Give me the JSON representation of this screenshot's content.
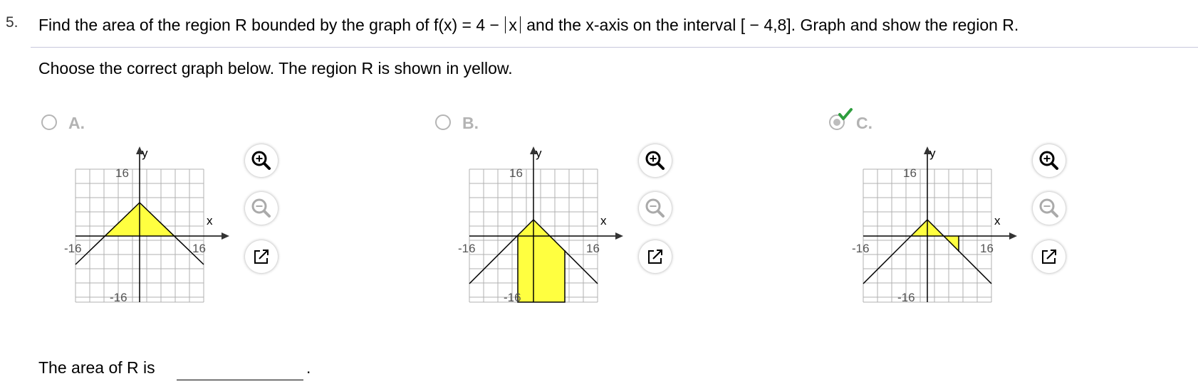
{
  "question": {
    "number": "5.",
    "text_part1": "Find the area of the region R bounded by the graph of f(x) = 4 −",
    "abs_inner": "x",
    "text_part2": "and the x-axis on the interval [ − 4,8]. Graph and show the region R."
  },
  "instruction": "Choose the correct graph below. The region R is shown in yellow.",
  "options": [
    {
      "label": "A.",
      "selected": false
    },
    {
      "label": "B.",
      "selected": false
    },
    {
      "label": "C.",
      "selected": true,
      "marked_correct": true
    }
  ],
  "graph_labels": {
    "x_axis": "x",
    "y_axis": "y",
    "tick_max": "16",
    "tick_min": "-16",
    "tick_neg_x": "-16"
  },
  "tools": {
    "zoom_in": "zoom-in-icon",
    "zoom_out": "zoom-out-icon",
    "popout": "popout-icon"
  },
  "answer": {
    "label": "The area of R is",
    "value": "",
    "suffix": "."
  },
  "colors": {
    "region_fill": "#ffff40",
    "grid": "#b0b0b0",
    "check": "#2e9e3e",
    "option_label": "#b3b3b3"
  }
}
